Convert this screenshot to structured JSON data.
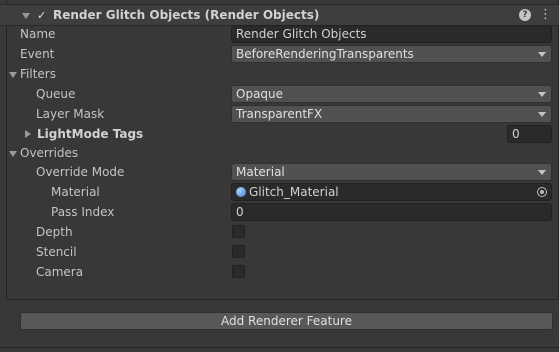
{
  "header": {
    "enabled": true,
    "title": "Render Glitch Objects (Render Objects)"
  },
  "fields": {
    "name_label": "Name",
    "name_value": "Render Glitch Objects",
    "event_label": "Event",
    "event_value": "BeforeRenderingTransparents",
    "filters_label": "Filters",
    "queue_label": "Queue",
    "queue_value": "Opaque",
    "layer_mask_label": "Layer Mask",
    "layer_mask_value": "TransparentFX",
    "lightmode_label": "LightMode Tags",
    "lightmode_value": "0",
    "overrides_label": "Overrides",
    "override_mode_label": "Override Mode",
    "override_mode_value": "Material",
    "material_label": "Material",
    "material_value": "Glitch_Material",
    "pass_index_label": "Pass Index",
    "pass_index_value": "0",
    "depth_label": "Depth",
    "stencil_label": "Stencil",
    "camera_label": "Camera"
  },
  "footer": {
    "add_button_label": "Add Renderer Feature"
  }
}
